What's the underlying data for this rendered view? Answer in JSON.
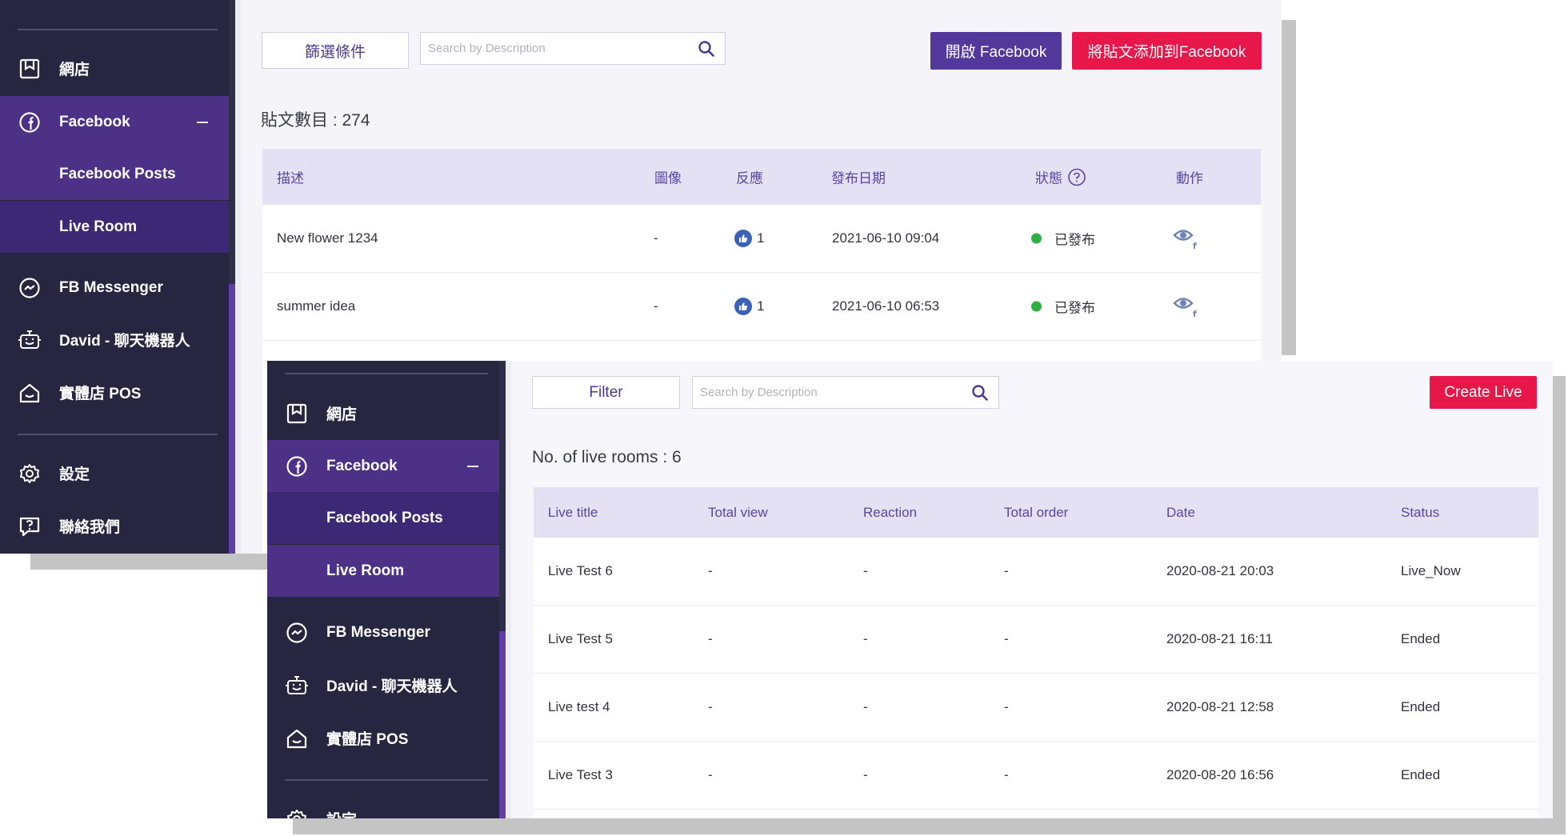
{
  "back": {
    "sidebar": {
      "items": [
        {
          "label": "網店",
          "icon": "store-icon"
        },
        {
          "label": "Facebook",
          "icon": "facebook-icon"
        },
        {
          "label": "Facebook Posts"
        },
        {
          "label": "Live Room"
        },
        {
          "label": "FB Messenger",
          "icon": "messenger-icon"
        },
        {
          "label": "David - 聊天機器人",
          "icon": "chatbot-icon"
        },
        {
          "label": "實體店 POS",
          "icon": "pos-icon"
        },
        {
          "label": "設定",
          "icon": "gear-icon"
        },
        {
          "label": "聯絡我們",
          "icon": "contact-icon"
        }
      ]
    },
    "toolbar": {
      "filter_label": "篩選條件",
      "search_placeholder": "Search by Description",
      "open_facebook_label": "開啟 Facebook",
      "add_post_label": "將貼文添加到Facebook"
    },
    "count_text": "貼文數目 : 274",
    "table": {
      "headers": [
        "描述",
        "圖像",
        "反應",
        "發布日期",
        "狀態",
        "動作"
      ],
      "rows": [
        {
          "description": "New flower 1234",
          "image": "-",
          "reaction": "1",
          "date": "2021-06-10 09:04",
          "status": "已發布"
        },
        {
          "description": "summer idea",
          "image": "-",
          "reaction": "1",
          "date": "2021-06-10 06:53",
          "status": "已發布"
        }
      ]
    }
  },
  "front": {
    "sidebar": {
      "items": [
        {
          "label": "網店",
          "icon": "store-icon"
        },
        {
          "label": "Facebook",
          "icon": "facebook-icon"
        },
        {
          "label": "Facebook Posts"
        },
        {
          "label": "Live Room"
        },
        {
          "label": "FB Messenger",
          "icon": "messenger-icon"
        },
        {
          "label": "David - 聊天機器人",
          "icon": "chatbot-icon"
        },
        {
          "label": "實體店 POS",
          "icon": "pos-icon"
        },
        {
          "label": "設定",
          "icon": "gear-icon"
        }
      ]
    },
    "toolbar": {
      "filter_label": "Filter",
      "search_placeholder": "Search by Description",
      "create_live_label": "Create Live"
    },
    "count_text": "No. of live rooms : 6",
    "table": {
      "headers": [
        "Live title",
        "Total view",
        "Reaction",
        "Total order",
        "Date",
        "Status"
      ],
      "rows": [
        {
          "title": "Live Test 6",
          "views": "-",
          "reaction": "-",
          "orders": "-",
          "date": "2020-08-21 20:03",
          "status": "Live_Now"
        },
        {
          "title": "Live Test 5",
          "views": "-",
          "reaction": "-",
          "orders": "-",
          "date": "2020-08-21 16:11",
          "status": "Ended"
        },
        {
          "title": "Live test 4",
          "views": "-",
          "reaction": "-",
          "orders": "-",
          "date": "2020-08-21 12:58",
          "status": "Ended"
        },
        {
          "title": "Live Test 3",
          "views": "-",
          "reaction": "-",
          "orders": "-",
          "date": "2020-08-20 16:56",
          "status": "Ended"
        }
      ]
    }
  },
  "colors": {
    "sidebar_bg": "#262640",
    "sidebar_active": "#4d3187",
    "sidebar_sub": "#3b2975",
    "accent_purple": "#53389b",
    "accent_red": "#e8174a",
    "header_bg": "#e3e1f3",
    "status_published": "#2eb144"
  }
}
